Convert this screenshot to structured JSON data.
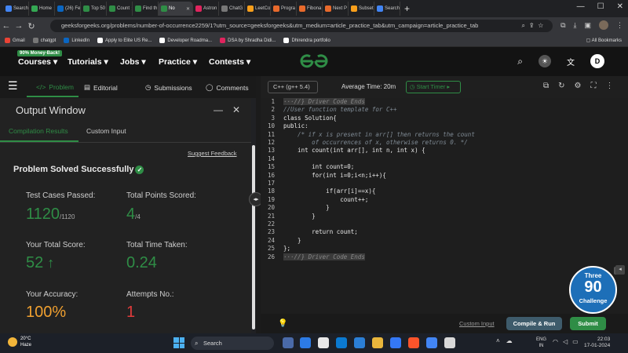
{
  "browser": {
    "tabs": [
      {
        "label": "Search",
        "color": "#4285f4"
      },
      {
        "label": "Home",
        "color": "#34a853"
      },
      {
        "label": "(26) Fe",
        "color": "#0a66c2"
      },
      {
        "label": "Top 50",
        "color": "#2f8d46"
      },
      {
        "label": "Count",
        "color": "#2f8d46"
      },
      {
        "label": "Find th",
        "color": "#2f8d46"
      },
      {
        "label": "No",
        "color": "#2f8d46"
      },
      {
        "label": "Astron",
        "color": "#e0245e"
      },
      {
        "label": "ChatG",
        "color": "#777777"
      },
      {
        "label": "LeetCo",
        "color": "#f89f1b"
      },
      {
        "label": "Progra",
        "color": "#e86a2c"
      },
      {
        "label": "Fibona",
        "color": "#e86a2c"
      },
      {
        "label": "Next P",
        "color": "#e86a2c"
      },
      {
        "label": "Subset",
        "color": "#f89f1b"
      },
      {
        "label": "Search",
        "color": "#4285f4"
      }
    ],
    "active_tab_index": 6,
    "url": "geeksforgeeks.org/problems/number-of-occurrence2259/1?utm_source=geeksforgeeks&utm_medium=article_practice_tab&utm_campaign=article_practice_tab",
    "bookmarks": [
      {
        "label": "Gmail",
        "color": "#ea4335"
      },
      {
        "label": "chatgpt",
        "color": "#777777"
      },
      {
        "label": "LinkedIn",
        "color": "#0a66c2"
      },
      {
        "label": "Apply to Elite US Re...",
        "color": "#ffffff"
      },
      {
        "label": "Developer Roadma...",
        "color": "#ffffff"
      },
      {
        "label": "DSA by Shradha Didi...",
        "color": "#e0245e"
      },
      {
        "label": "Dhirendra portfolio",
        "color": "#ffffff"
      }
    ],
    "all_bookmarks": "All Bookmarks"
  },
  "gfg": {
    "money_back": "90% Money-Back!",
    "nav": [
      "Courses ▾",
      "Tutorials ▾",
      "Jobs ▾",
      "Practice ▾",
      "Contests ▾"
    ],
    "avatar_letter": "D",
    "brand_color": "#2f8d46"
  },
  "problem_tabs": {
    "problem": "Problem",
    "editorial": "Editorial",
    "submissions": "Submissions",
    "comments": "Comments"
  },
  "output": {
    "title": "Output Window",
    "tabs": {
      "compilation": "Compilation Results",
      "custom": "Custom Input"
    },
    "suggest_feedback": "Suggest Feedback",
    "status": "Problem Solved Successfully",
    "stats": {
      "test_cases_label": "Test Cases Passed:",
      "test_cases_value": "1120",
      "test_cases_total": "/1120",
      "points_label": "Total Points Scored:",
      "points_value": "4",
      "points_total": "/4",
      "score_label": "Your Total Score:",
      "score_value": "52",
      "time_label": "Total Time Taken:",
      "time_value": "0.24",
      "accuracy_label": "Your Accuracy:",
      "accuracy_value": "100%",
      "attempts_label": "Attempts No.:",
      "attempts_value": "1"
    },
    "colors": {
      "green": "#2f8d46",
      "orange": "#f0a030",
      "red": "#e03b3b"
    }
  },
  "editor": {
    "language": "C++ (g++ 5.4)",
    "avg_time": "Average Time: 20m",
    "timer": "Start Timer",
    "lines": [
      {
        "n": "1",
        "text": "//} Driver Code Ends",
        "kind": "fold"
      },
      {
        "n": "2",
        "text": "//User function template for C++",
        "kind": "comment"
      },
      {
        "n": "3",
        "text": "class Solution{",
        "kind": "code"
      },
      {
        "n": "10",
        "text": "public:",
        "kind": "code"
      },
      {
        "n": "11",
        "text": "    /* if x is present in arr[] then returns the count",
        "kind": "comment"
      },
      {
        "n": "12",
        "text": "        of occurrences of x, otherwise returns 0. */",
        "kind": "comment"
      },
      {
        "n": "13",
        "text": "    int count(int arr[], int n, int x) {",
        "kind": "code"
      },
      {
        "n": "14",
        "text": "",
        "kind": "code"
      },
      {
        "n": "15",
        "text": "        int count=0;",
        "kind": "code"
      },
      {
        "n": "16",
        "text": "        for(int i=0;i<n;i++){",
        "kind": "code"
      },
      {
        "n": "17",
        "text": "",
        "kind": "code"
      },
      {
        "n": "18",
        "text": "            if(arr[i]==x){",
        "kind": "code"
      },
      {
        "n": "19",
        "text": "                count++;",
        "kind": "code"
      },
      {
        "n": "20",
        "text": "            }",
        "kind": "code"
      },
      {
        "n": "21",
        "text": "        }",
        "kind": "code"
      },
      {
        "n": "22",
        "text": "",
        "kind": "code"
      },
      {
        "n": "23",
        "text": "        return count;",
        "kind": "code"
      },
      {
        "n": "24",
        "text": "    }",
        "kind": "code"
      },
      {
        "n": "25",
        "text": "};",
        "kind": "code"
      },
      {
        "n": "26",
        "text": "//} Driver Code Ends",
        "kind": "fold"
      }
    ],
    "custom_input": "Custom Input",
    "compile_run": "Compile & Run",
    "submit": "Submit",
    "promo": {
      "top": "Three",
      "num": "90",
      "bottom": "Challenge"
    }
  },
  "taskbar": {
    "weather_temp": "20°C",
    "weather_desc": "Haze",
    "search": "Search",
    "lang_line1": "ENG",
    "lang_line2": "IN",
    "time": "22:03",
    "date": "17-01-2024"
  }
}
